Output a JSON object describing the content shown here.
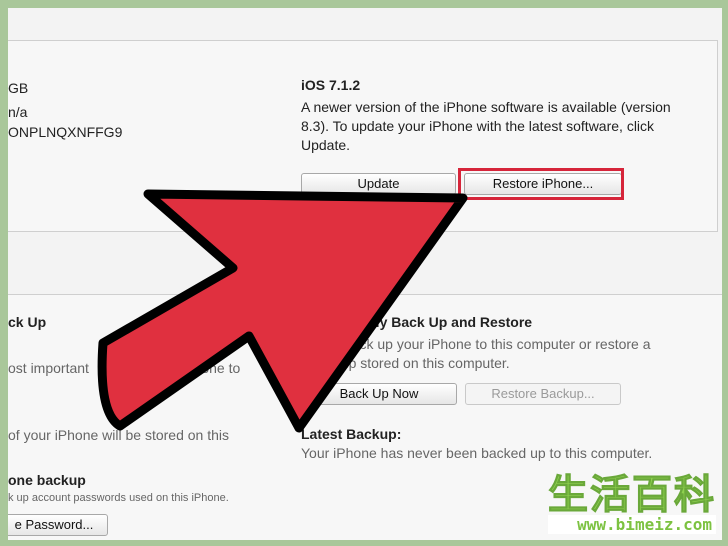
{
  "summary": {
    "capacity": "GB",
    "phone": "n/a",
    "serial": "ONPLNQXNFFG9",
    "ios_title": "iOS 7.1.2",
    "ios_desc_1": "A newer version of the iPhone software is available (version",
    "ios_desc_2": "8.3). To update your iPhone with the latest software, click",
    "ios_desc_3": "Update.",
    "update_label": "Update",
    "restore_iphone_label": "Restore iPhone..."
  },
  "backups": {
    "left_heading": "ck Up",
    "left_line1": "ost important",
    "left_line1b": "your iPhone to",
    "left_line2": "of your iPhone will be stored on this",
    "left_heading2": "one backup",
    "left_small": "k up account passwords used on this iPhone.",
    "change_password_label": "e Password...",
    "right_heading": "ally Back Up and Restore",
    "right_line1": "ally back up your iPhone to this computer or restore a",
    "right_line2": "ackup stored on this computer.",
    "backup_now_label": "Back Up Now",
    "restore_backup_label": "Restore Backup...",
    "latest_heading": "Latest Backup:",
    "latest_text": "Your iPhone has never been backed up to this computer."
  },
  "watermark": {
    "chinese": "生活百科",
    "url": "www.bimeiz.com"
  },
  "colors": {
    "arrow_red": "#e0303f",
    "highlight_red": "#d6253a",
    "frame_green": "#a9c79a"
  }
}
